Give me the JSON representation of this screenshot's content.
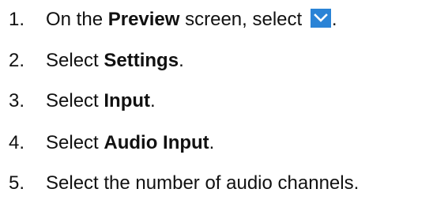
{
  "steps": [
    {
      "number": "1.",
      "prefix": "On the ",
      "bold": "Preview",
      "middle": " screen, select ",
      "icon": "chevron-down-icon",
      "suffix": "."
    },
    {
      "number": "2.",
      "prefix": "Select ",
      "bold": "Settings",
      "suffix": "."
    },
    {
      "number": "3.",
      "prefix": "Select ",
      "bold": "Input",
      "suffix": "."
    },
    {
      "number": "4.",
      "prefix": "Select ",
      "bold": "Audio Input",
      "suffix": "."
    },
    {
      "number": "5.",
      "text": "Select the number of audio channels."
    }
  ],
  "colors": {
    "icon_background": "#2a83d6",
    "icon_chevron": "#ffffff",
    "text": "#111111"
  }
}
